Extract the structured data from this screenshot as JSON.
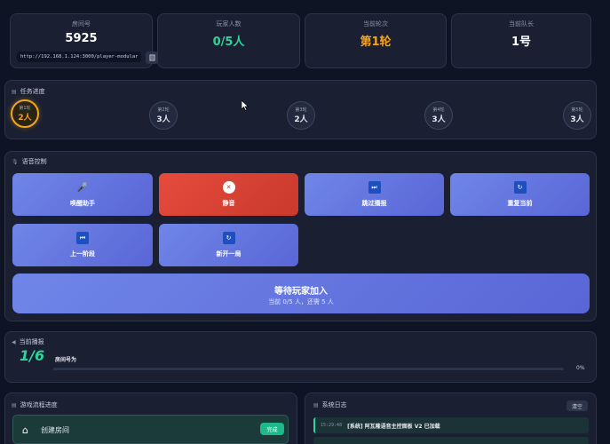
{
  "stats": {
    "room": {
      "label": "房间号",
      "value": "5925",
      "url": "http://192.168.1.124:3000/player-modular"
    },
    "players": {
      "label": "玩家人数",
      "value": "0/5人",
      "color": "#2fd49a"
    },
    "round": {
      "label": "当前轮次",
      "value": "第1轮",
      "color": "#f2a421"
    },
    "captain": {
      "label": "当前队长",
      "value": "1号",
      "color": "#ffffff"
    }
  },
  "mission": {
    "title": "任务进度",
    "rounds": [
      {
        "label": "第1轮",
        "count": "2人",
        "active": true
      },
      {
        "label": "第2轮",
        "count": "3人",
        "active": false
      },
      {
        "label": "第3轮",
        "count": "2人",
        "active": false
      },
      {
        "label": "第4轮",
        "count": "3人",
        "active": false
      },
      {
        "label": "第5轮",
        "count": "3人",
        "active": false
      }
    ]
  },
  "voice": {
    "title": "语音控制",
    "buttons": [
      {
        "label": "唤醒助手",
        "icon": "microphone-icon",
        "glyph": "🎤"
      },
      {
        "label": "静音",
        "icon": "mute-icon",
        "glyph": "🔇"
      },
      {
        "label": "跳过播报",
        "icon": "skip-icon",
        "glyph": "⏭"
      },
      {
        "label": "重复当前",
        "icon": "repeat-icon",
        "glyph": "🔄"
      },
      {
        "label": "上一阶段",
        "icon": "previous-icon",
        "glyph": "⏮"
      },
      {
        "label": "新开一局",
        "icon": "new-game-icon",
        "glyph": "🔄"
      }
    ],
    "wait_title": "等待玩家加入",
    "wait_sub": "当前 0/5 人，还需 5 人"
  },
  "playback": {
    "title": "当前播报",
    "progress": "1/6",
    "text": "房间号为",
    "percent_label": "0%",
    "percent": 0
  },
  "flow": {
    "title": "游戏流程进度",
    "items": [
      {
        "label": "创建房间",
        "badge": "完成"
      }
    ]
  },
  "log": {
    "title": "系统日志",
    "clear": "清空",
    "entries": [
      {
        "time": "15:29:48",
        "text": "[系统] 阿瓦隆语音主控面板 V2 已加载"
      }
    ]
  }
}
